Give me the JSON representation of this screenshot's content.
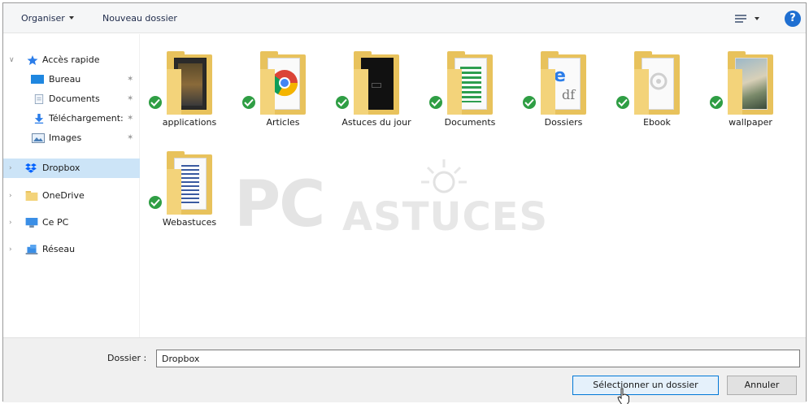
{
  "toolbar": {
    "organise": "Organiser",
    "new_folder": "Nouveau dossier",
    "help": "?"
  },
  "nav": {
    "items": [
      {
        "label": "Accès rapide",
        "icon": "star-icon",
        "expanded": true
      },
      {
        "label": "Bureau",
        "icon": "desktop-icon",
        "pinned": true
      },
      {
        "label": "Documents",
        "icon": "documents-icon",
        "pinned": true
      },
      {
        "label": "Téléchargement:",
        "icon": "download-icon",
        "pinned": true
      },
      {
        "label": "Images",
        "icon": "images-icon",
        "pinned": true
      },
      {
        "label": "Dropbox",
        "icon": "dropbox-icon",
        "selected": true
      },
      {
        "label": "OneDrive",
        "icon": "folder-icon"
      },
      {
        "label": "Ce PC",
        "icon": "computer-icon"
      },
      {
        "label": "Réseau",
        "icon": "network-icon"
      }
    ]
  },
  "folders": [
    {
      "label": "applications"
    },
    {
      "label": "Articles"
    },
    {
      "label": "Astuces du jour"
    },
    {
      "label": "Documents"
    },
    {
      "label": "Dossiers"
    },
    {
      "label": "Ebook"
    },
    {
      "label": "wallpaper"
    },
    {
      "label": "Webastuces"
    }
  ],
  "watermark": {
    "pc": "PC",
    "astuces": "ASTUCES"
  },
  "bottom": {
    "folder_label": "Dossier :",
    "folder_value": "Dropbox",
    "select_button": "Sélectionner un dossier",
    "cancel_button": "Annuler"
  },
  "colors": {
    "selected_bg": "#cce4f7",
    "folder": "#e8c25c",
    "sync_ok": "#2f9e44",
    "accent": "#0078d7"
  }
}
